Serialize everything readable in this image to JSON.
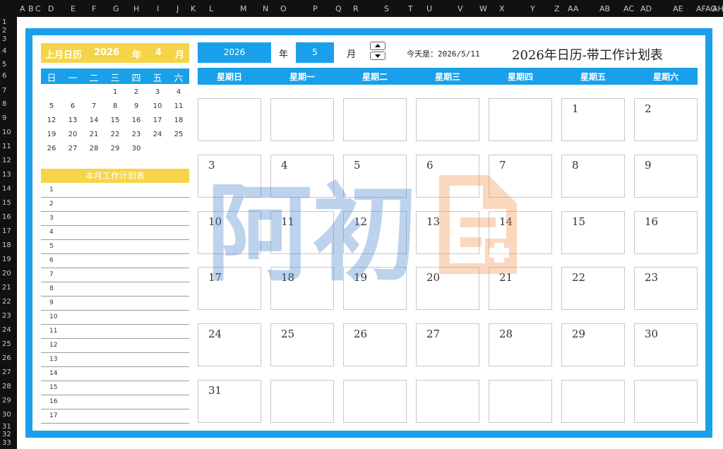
{
  "spreadsheet": {
    "columns": [
      "A",
      "B",
      "C",
      "D",
      "E",
      "F",
      "G",
      "H",
      "I",
      "J",
      "K",
      "L",
      "M",
      "N",
      "O",
      "P",
      "Q",
      "R",
      "S",
      "T",
      "U",
      "V",
      "W",
      "X",
      "Y",
      "Z",
      "AA",
      "AB",
      "AC",
      "AD",
      "AE",
      "AF",
      "AG",
      "AH"
    ],
    "rows": [
      "1",
      "2",
      "3",
      "4",
      "5",
      "6",
      "7",
      "8",
      "9",
      "10",
      "11",
      "12",
      "13",
      "14",
      "15",
      "16",
      "17",
      "18",
      "19",
      "20",
      "21",
      "22",
      "23",
      "24",
      "25",
      "26",
      "27",
      "28",
      "29",
      "30",
      "31",
      "32",
      "33"
    ]
  },
  "prev_month": {
    "label": "上月日历",
    "year": "2026",
    "year_unit": "年",
    "month": "4",
    "month_unit": "月",
    "weekdays": [
      "日",
      "一",
      "二",
      "三",
      "四",
      "五",
      "六"
    ],
    "weeks": [
      [
        "",
        "",
        "",
        "1",
        "2",
        "3",
        "4"
      ],
      [
        "5",
        "6",
        "7",
        "8",
        "9",
        "10",
        "11"
      ],
      [
        "12",
        "13",
        "14",
        "15",
        "16",
        "17",
        "18"
      ],
      [
        "19",
        "20",
        "21",
        "22",
        "23",
        "24",
        "25"
      ],
      [
        "26",
        "27",
        "28",
        "29",
        "30",
        "",
        ""
      ]
    ]
  },
  "plan": {
    "title": "本月工作计划表",
    "rows": [
      "1",
      "2",
      "3",
      "4",
      "5",
      "6",
      "7",
      "8",
      "9",
      "10",
      "11",
      "12",
      "13",
      "14",
      "15",
      "16",
      "17"
    ]
  },
  "controls": {
    "year_value": "2026",
    "year_label": "年",
    "month_value": "5",
    "month_label": "月",
    "today_text": "今天是：2026/5/11"
  },
  "title": "2026年日历-带工作计划表",
  "calendar": {
    "weekdays": [
      "星期日",
      "星期一",
      "星期二",
      "星期三",
      "星期四",
      "星期五",
      "星期六"
    ],
    "weeks": [
      [
        "",
        "",
        "",
        "",
        "",
        "1",
        "2"
      ],
      [
        "3",
        "4",
        "5",
        "6",
        "7",
        "8",
        "9"
      ],
      [
        "10",
        "11",
        "12",
        "13",
        "14",
        "15",
        "16"
      ],
      [
        "17",
        "18",
        "19",
        "20",
        "21",
        "22",
        "23"
      ],
      [
        "24",
        "25",
        "26",
        "27",
        "28",
        "29",
        "30"
      ],
      [
        "31",
        "",
        "",
        "",
        "",
        "",
        ""
      ]
    ]
  },
  "watermark": {
    "text": "阿初",
    "color_text": "#3a78c8",
    "color_icon": "#f08a40"
  },
  "colors": {
    "accent": "#1aa0ea",
    "yellow": "#f6d44a"
  }
}
